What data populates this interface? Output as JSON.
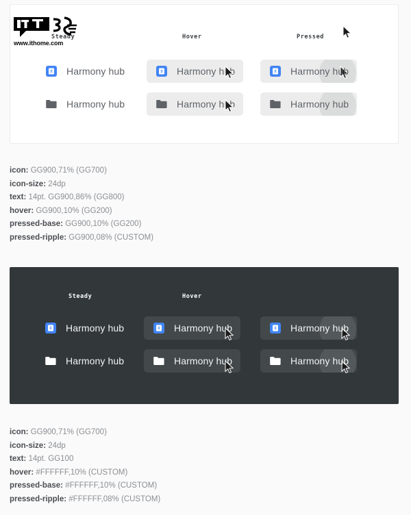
{
  "columns": [
    "Steady",
    "Hover",
    "Pressed"
  ],
  "light_panel": {
    "rows": [
      {
        "icon": "harmony-hub-app-icon",
        "cells": [
          {
            "state": "steady",
            "label": "Harmony hub"
          },
          {
            "state": "hover",
            "label": "Harmony hub"
          },
          {
            "state": "pressed",
            "label": "Harmony hub"
          }
        ]
      },
      {
        "icon": "folder-icon",
        "cells": [
          {
            "state": "steady",
            "label": "Harmony hub"
          },
          {
            "state": "hover",
            "label": "Harmony hub"
          },
          {
            "state": "pressed",
            "label": "Harmony hub"
          }
        ]
      }
    ]
  },
  "dark_panel": {
    "rows": [
      {
        "icon": "harmony-hub-app-icon",
        "cells": [
          {
            "state": "steady",
            "label": "Harmony hub"
          },
          {
            "state": "hover",
            "label": "Harmony hub"
          },
          {
            "state": "pressed",
            "label": "Harmony hub"
          }
        ]
      },
      {
        "icon": "folder-icon",
        "cells": [
          {
            "state": "steady",
            "label": "Harmony hub"
          },
          {
            "state": "hover",
            "label": "Harmony hub"
          },
          {
            "state": "pressed",
            "label": "Harmony hub"
          }
        ]
      }
    ]
  },
  "spec_light": [
    {
      "key": "icon:",
      "value": "GG900,71% (GG700)"
    },
    {
      "key": "icon-size:",
      "value": "24dp"
    },
    {
      "key": "text:",
      "value": "14pt. GG900,86% (GG800)"
    },
    {
      "key": "hover:",
      "value": "GG900,10% (GG200)"
    },
    {
      "key": "pressed-base:",
      "value": "GG900,10% (GG200)"
    },
    {
      "key": "pressed-ripple:",
      "value": "GG900,08%  (CUSTOM)"
    }
  ],
  "spec_dark": [
    {
      "key": "icon:",
      "value": "GG900,71% (GG700)"
    },
    {
      "key": "icon-size:",
      "value": "24dp"
    },
    {
      "key": "text:",
      "value": "14pt. GG100"
    },
    {
      "key": "hover:",
      "value": "#FFFFFF,10% (CUSTOM)"
    },
    {
      "key": "pressed-base:",
      "value": "#FFFFFF,10% (CUSTOM)"
    },
    {
      "key": "pressed-ripple:",
      "value": "#FFFFFF,08%  (CUSTOM)"
    }
  ],
  "watermark": {
    "mark": "IT之家",
    "url": "www.ithome.com"
  },
  "colors": {
    "app_icon_blue": "#4285f4",
    "folder_gray": "#5f6368",
    "folder_white": "#ffffff",
    "light_panel_bg": "#ffffff",
    "dark_panel_bg": "#32373a",
    "hover_light": "#ececec",
    "hover_dark": "#43484b",
    "page_bg": "#fafafb"
  }
}
